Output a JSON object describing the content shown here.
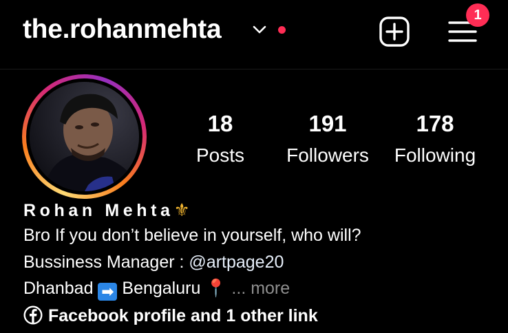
{
  "header": {
    "username": "the.rohanmehta",
    "notification_count": "1",
    "icons": [
      "chevron-down-icon",
      "new-post-icon",
      "menu-icon"
    ]
  },
  "profile": {
    "stats": [
      {
        "value": "18",
        "label": "Posts"
      },
      {
        "value": "191",
        "label": "Followers"
      },
      {
        "value": "178",
        "label": "Following"
      }
    ],
    "name": "Rohan Mehta",
    "name_emoji": "⚜",
    "bio_line1": "Bro If you don’t believe in yourself, who will?",
    "bio_line2_prefix": "Bussiness Manager : ",
    "bio_line2_mention": "@artpage20",
    "bio_line3_from": "Dhanbad",
    "bio_line3_arrow": "➡",
    "bio_line3_to": "Bengaluru",
    "bio_line3_pin": "📍",
    "more_label": "... more",
    "link_text": "Facebook profile and 1 other link"
  },
  "colors": {
    "background": "#000000",
    "badge": "#ff2d55",
    "ring_gradient": [
      "#feda75",
      "#fa7e1e",
      "#d62976",
      "#962fbf"
    ]
  }
}
